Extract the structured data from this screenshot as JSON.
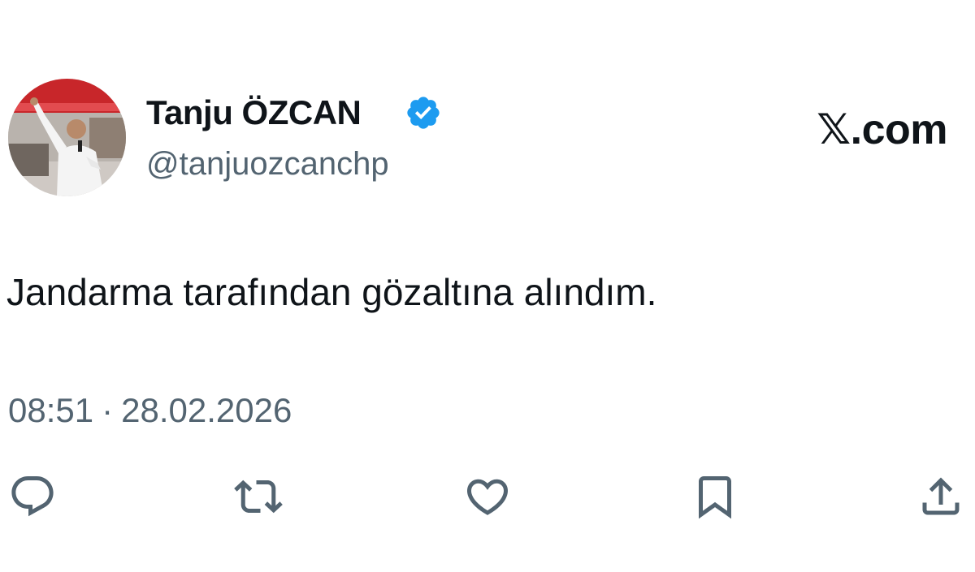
{
  "tweet": {
    "author": {
      "name": "Tanju ÖZCAN",
      "handle": "@tanjuozcanchp",
      "verified": true,
      "verified_color": "#1d9bf0"
    },
    "site_logo": "𝕏.com",
    "text": "Jandarma tarafından gözaltına alındım.",
    "time": "08:51",
    "separator": "·",
    "date": "28.02.2026",
    "actions": [
      {
        "name": "reply",
        "icon": "reply-icon"
      },
      {
        "name": "repost",
        "icon": "repost-icon"
      },
      {
        "name": "like",
        "icon": "heart-icon"
      },
      {
        "name": "bookmark",
        "icon": "bookmark-icon"
      },
      {
        "name": "share",
        "icon": "share-icon"
      }
    ],
    "colors": {
      "text": "#0f1419",
      "secondary": "#536471",
      "icon": "#536471"
    }
  }
}
